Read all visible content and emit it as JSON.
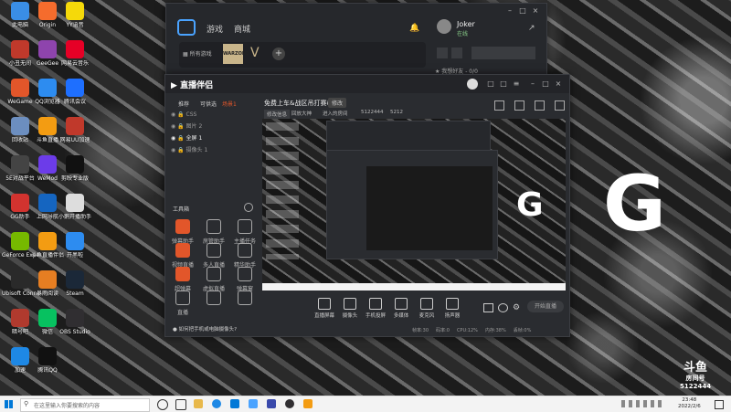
{
  "desktop": {
    "icons": [
      {
        "label": "此电脑",
        "color": "#3a8ee6"
      },
      {
        "label": "小丑无间",
        "color": "#c0392b"
      },
      {
        "label": "WeGame",
        "color": "#e2562a"
      },
      {
        "label": "回收站",
        "color": "#6c8ebf"
      },
      {
        "label": "5E对战平台",
        "color": "#444"
      },
      {
        "label": "GG助手",
        "color": "#d2332f"
      },
      {
        "label": "GeForce Experience",
        "color": "#76b900"
      },
      {
        "label": "Ubisoft Connect",
        "color": "#2a2a2a"
      },
      {
        "label": "暗号吧",
        "color": "#b03a2e"
      },
      {
        "label": "加速",
        "color": "#1e88e5"
      },
      {
        "label": "Origin",
        "color": "#f56c2d"
      },
      {
        "label": "GeeGee",
        "color": "#8e44ad"
      },
      {
        "label": "QQ浏览器",
        "color": "#2d8cf0"
      },
      {
        "label": "斗鱼直播",
        "color": "#f39c12"
      },
      {
        "label": "WeMod",
        "color": "#6c3ce9"
      },
      {
        "label": "上网导航",
        "color": "#1565c0"
      },
      {
        "label": "斗鱼直播伴侣",
        "color": "#f39c12"
      },
      {
        "label": "暴雨阅读",
        "color": "#e67e22"
      },
      {
        "label": "微信",
        "color": "#07c160"
      },
      {
        "label": "腾讯QQ",
        "color": "#111"
      },
      {
        "label": "YY语音",
        "color": "#f5d90a"
      },
      {
        "label": "网易云音乐",
        "color": "#e60026"
      },
      {
        "label": "腾讯会议",
        "color": "#1e6fff"
      },
      {
        "label": "网易UU加速",
        "color": "#c0392b"
      },
      {
        "label": "剪映专业版",
        "color": "#111"
      },
      {
        "label": "小鹅开播助手",
        "color": "#ddd"
      },
      {
        "label": "开黑啦",
        "color": "#2d8cf0"
      },
      {
        "label": "Steam",
        "color": "#1b2838"
      },
      {
        "label": "OBS Studio",
        "color": "#302e31"
      }
    ]
  },
  "wallpaper": {
    "logo_text": "G"
  },
  "launcher": {
    "nav": [
      "游戏",
      "商城"
    ],
    "library_label": "所有游戏",
    "game_tiles": [
      "WARZONE",
      "V"
    ],
    "add": "+",
    "user_name": "Joker",
    "user_status": "在线",
    "friends_label": "★ 我想好友 - 0/0"
  },
  "stream": {
    "logo": "直播伴侣",
    "tabs": [
      "推荐",
      "可供选",
      "场景1"
    ],
    "title": "免费上车&战区吊打赛&",
    "title_tag": "修改",
    "room_id": "5122444",
    "fans": "5212",
    "meta": [
      "修改信息",
      "回放大神",
      "进入的房间"
    ],
    "scenes": [
      "CSS",
      "图片 2",
      "全屏 1",
      "摄像头 1"
    ],
    "toolbox_label": "工具箱",
    "tools": [
      {
        "label": "弹幕助手",
        "accent": true
      },
      {
        "label": "房管助手",
        "accent": false
      },
      {
        "label": "主播任务",
        "accent": false
      },
      {
        "label": "视频直播",
        "accent": true
      },
      {
        "label": "多人直播",
        "accent": false
      },
      {
        "label": "精华助手",
        "accent": false
      },
      {
        "label": "超弹幕",
        "accent": true
      },
      {
        "label": "虚拟直播",
        "accent": false
      },
      {
        "label": "弹幕窗",
        "accent": false
      },
      {
        "label": "直播",
        "accent": false
      },
      {
        "label": "",
        "accent": false
      },
      {
        "label": "",
        "accent": false
      }
    ],
    "bottom_tools": [
      "直播屏幕",
      "摄像头",
      "手机投屏",
      "多媒体",
      "麦克风",
      "扬声器"
    ],
    "start_button": "开始直播",
    "hint": "如何把手机或电脑摄像头?",
    "status": [
      "帧率:30",
      "码率:0",
      "CPU:12%",
      "内存:38%",
      "丢帧:0%"
    ]
  },
  "watermark": {
    "brand": "斗鱼",
    "room_label": "房间号",
    "room_no": "5122444"
  },
  "taskbar": {
    "search_placeholder": "在这里输入你要搜索的内容",
    "time": "23:48",
    "date": "2022/2/6"
  }
}
